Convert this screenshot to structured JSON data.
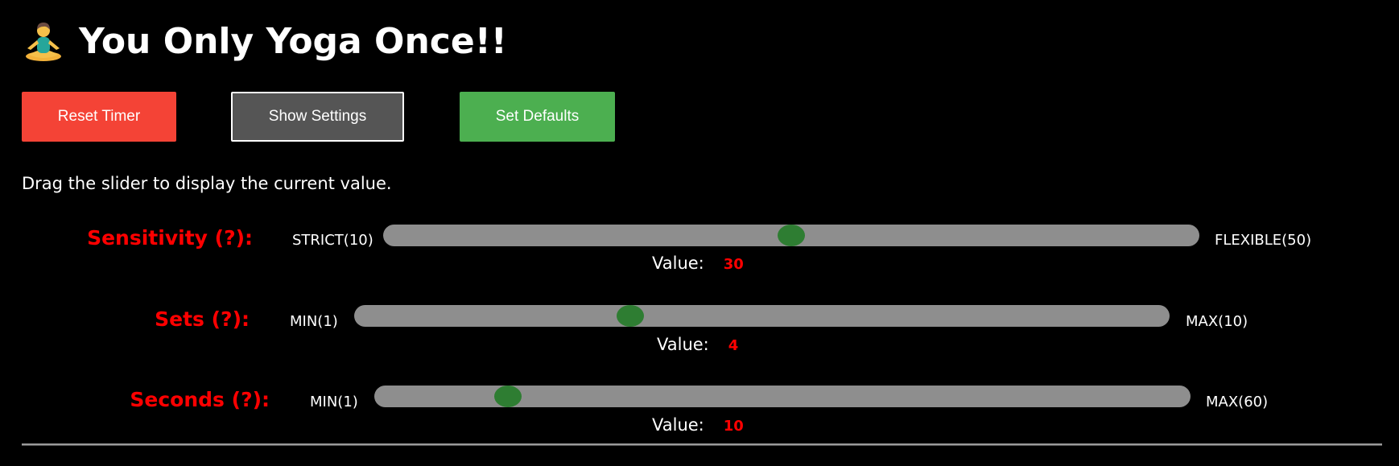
{
  "header": {
    "icon": "person-in-lotus-position-icon",
    "title": "You Only Yoga Once!!"
  },
  "toolbar": {
    "reset_label": "Reset Timer",
    "show_settings_label": "Show Settings",
    "set_defaults_label": "Set Defaults"
  },
  "hint": "Drag the slider to display the current value.",
  "value_label": "Value:",
  "sliders": {
    "sensitivity": {
      "label": "Sensitivity (?):",
      "min_label": "STRICT(10)",
      "max_label": "FLEXIBLE(50)",
      "min": 10,
      "max": 50,
      "value": 30
    },
    "sets": {
      "label": "Sets (?):",
      "min_label": "MIN(1)",
      "max_label": "MAX(10)",
      "min": 1,
      "max": 10,
      "value": 4
    },
    "seconds": {
      "label": "Seconds (?):",
      "min_label": "MIN(1)",
      "max_label": "MAX(60)",
      "min": 1,
      "max": 60,
      "value": 10
    }
  },
  "colors": {
    "reset_button": "#f44336",
    "show_settings_button": "#555555",
    "set_defaults_button": "#4caf50",
    "slider_label": "#ff0000",
    "value_number": "#ff0000",
    "slider_track": "#8e8e8e",
    "slider_thumb": "#2e7d32"
  }
}
